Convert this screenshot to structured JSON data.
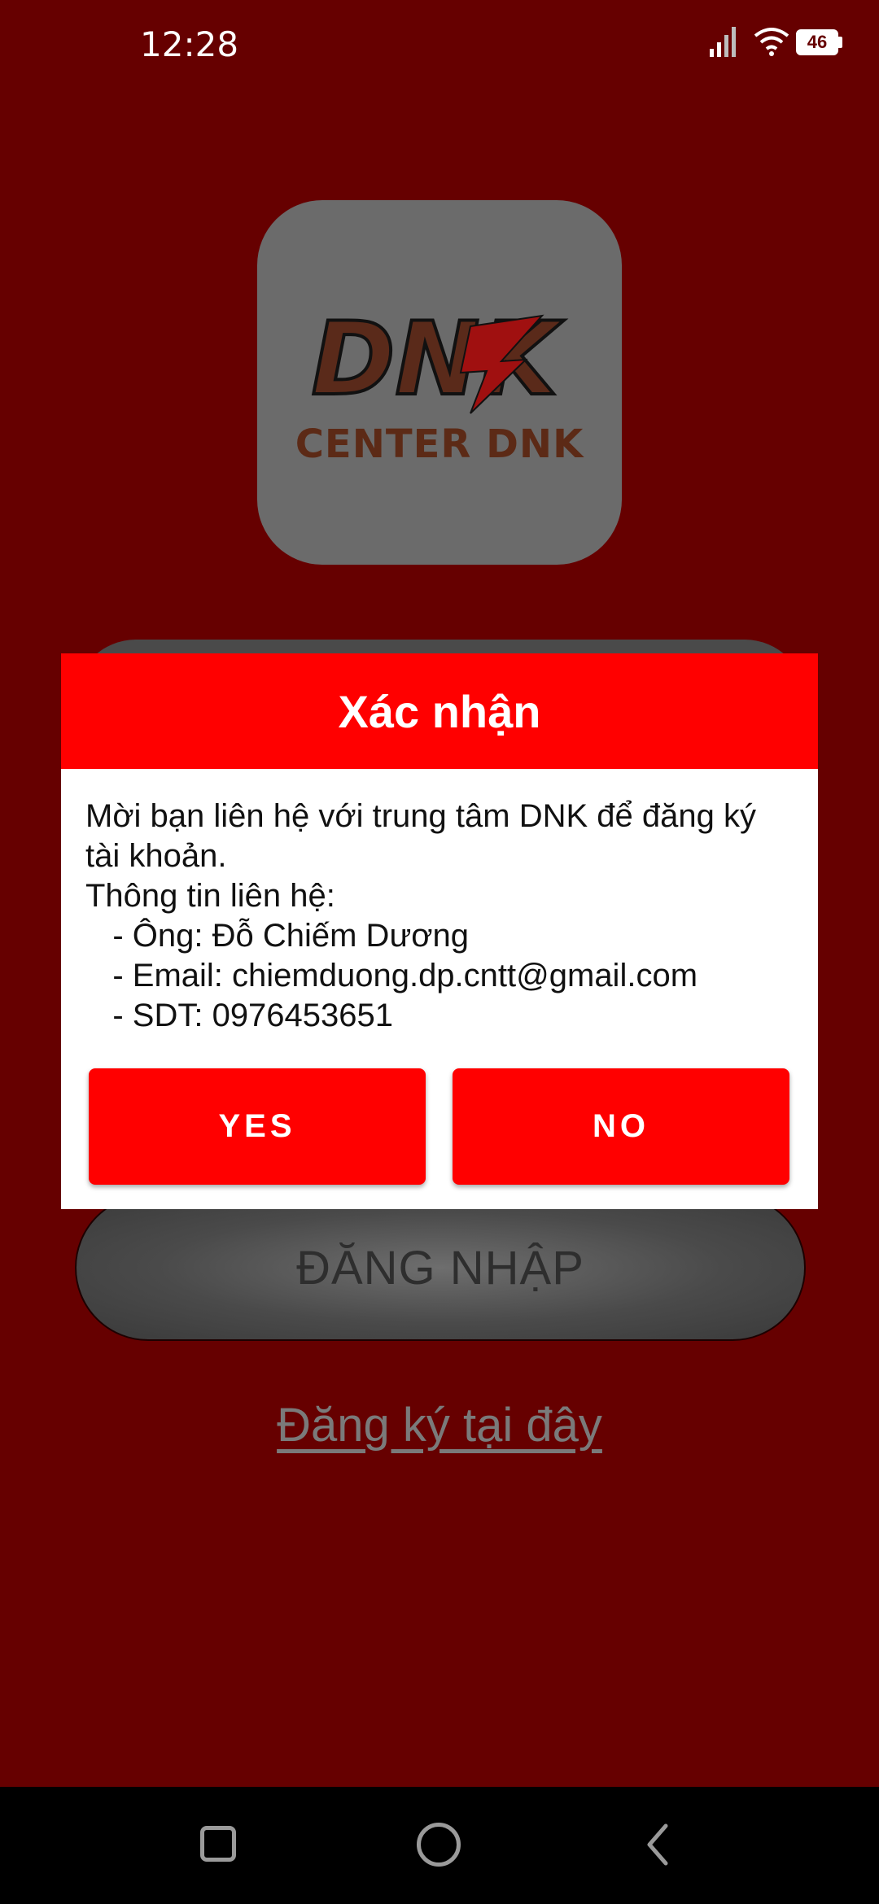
{
  "status_bar": {
    "time": "12:28",
    "battery": "46"
  },
  "logo": {
    "mark": "DNK",
    "caption": "CENTER DNK"
  },
  "login_button": {
    "label": "ĐĂNG NHẬP"
  },
  "register_link": {
    "label": "Đăng ký tại đây"
  },
  "dialog": {
    "title": "Xác nhận",
    "lines": [
      "Mời bạn liên hệ với trung tâm DNK để đăng ký",
      "tài khoản.",
      "Thông tin liên hệ:",
      "   - Ông: Đỗ Chiếm Dương",
      "   - Email: chiemduong.dp.cntt@gmail.com",
      "   - SDT: 0976453651"
    ],
    "yes_label": "YES",
    "no_label": "NO"
  },
  "colors": {
    "background": "#660000",
    "dialog_header": "#ff0000",
    "button": "#ff0000"
  },
  "nav_bar": {
    "icons": [
      "recents-square-icon",
      "home-circle-icon",
      "back-chevron-icon"
    ]
  }
}
